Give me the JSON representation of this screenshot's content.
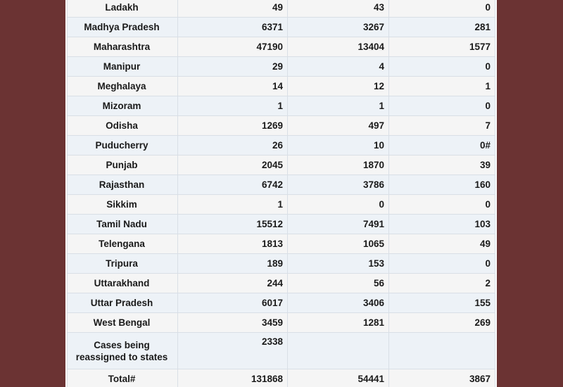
{
  "rows": [
    {
      "state": "Ladakh",
      "c1": "49",
      "c2": "43",
      "c3": "0"
    },
    {
      "state": "Madhya Pradesh",
      "c1": "6371",
      "c2": "3267",
      "c3": "281"
    },
    {
      "state": "Maharashtra",
      "c1": "47190",
      "c2": "13404",
      "c3": "1577"
    },
    {
      "state": "Manipur",
      "c1": "29",
      "c2": "4",
      "c3": "0"
    },
    {
      "state": "Meghalaya",
      "c1": "14",
      "c2": "12",
      "c3": "1"
    },
    {
      "state": "Mizoram",
      "c1": "1",
      "c2": "1",
      "c3": "0"
    },
    {
      "state": "Odisha",
      "c1": "1269",
      "c2": "497",
      "c3": "7"
    },
    {
      "state": "Puducherry",
      "c1": "26",
      "c2": "10",
      "c3": "0#"
    },
    {
      "state": "Punjab",
      "c1": "2045",
      "c2": "1870",
      "c3": "39"
    },
    {
      "state": "Rajasthan",
      "c1": "6742",
      "c2": "3786",
      "c3": "160"
    },
    {
      "state": "Sikkim",
      "c1": "1",
      "c2": "0",
      "c3": "0"
    },
    {
      "state": "Tamil Nadu",
      "c1": "15512",
      "c2": "7491",
      "c3": "103"
    },
    {
      "state": "Telengana",
      "c1": "1813",
      "c2": "1065",
      "c3": "49"
    },
    {
      "state": "Tripura",
      "c1": "189",
      "c2": "153",
      "c3": "0"
    },
    {
      "state": "Uttarakhand",
      "c1": "244",
      "c2": "56",
      "c3": "2"
    },
    {
      "state": "Uttar Pradesh",
      "c1": "6017",
      "c2": "3406",
      "c3": "155"
    },
    {
      "state": "West Bengal",
      "c1": "3459",
      "c2": "1281",
      "c3": "269"
    },
    {
      "state": "Cases being reassigned to states",
      "c1": "2338",
      "c2": "",
      "c3": ""
    },
    {
      "state": "Total#",
      "c1": "131868",
      "c2": "54441",
      "c3": "3867"
    }
  ]
}
